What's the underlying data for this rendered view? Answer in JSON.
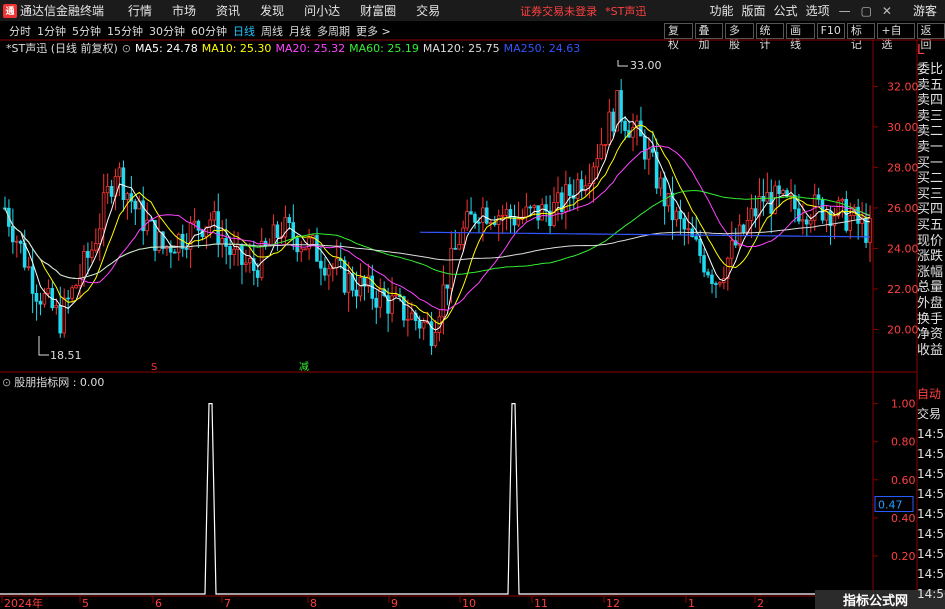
{
  "app": {
    "title": "通达信金融终端",
    "notice": "证券交易未登录",
    "stock_tag": "*ST声迅",
    "guest": "游客"
  },
  "menus": [
    "行情",
    "市场",
    "资讯",
    "发现",
    "问小达",
    "财富圈",
    "交易"
  ],
  "right_menus": [
    "功能",
    "版面",
    "公式",
    "选项"
  ],
  "window_buttons": [
    "—",
    "▢",
    "✕"
  ],
  "periods": [
    "分时",
    "1分钟",
    "5分钟",
    "15分钟",
    "30分钟",
    "60分钟",
    "日线",
    "周线",
    "月线",
    "多周期",
    "更多 >"
  ],
  "active_period": "日线",
  "tool_buttons": [
    "复权",
    "叠加",
    "多股",
    "统计",
    "画线",
    "F10",
    "标记",
    "+自选",
    "返回"
  ],
  "stock_label": "*ST声迅 (日线 前复权)",
  "ma": [
    {
      "label": "MA5: 24.78",
      "color": "#ffffff"
    },
    {
      "label": "MA10: 25.30",
      "color": "#ffff00"
    },
    {
      "label": "MA20: 25.32",
      "color": "#ff44ff"
    },
    {
      "label": "MA60: 25.19",
      "color": "#33ee33"
    },
    {
      "label": "MA120: 25.75",
      "color": "#dddddd"
    },
    {
      "label": "MA250: 24.63",
      "color": "#3355ff"
    }
  ],
  "price_axis": [
    "32.00",
    "30.00",
    "28.00",
    "26.00",
    "24.00",
    "22.00",
    "20.00"
  ],
  "high_label": "33.00",
  "low_label": "18.51",
  "indicator_label": "股朋指标网 : 0.00",
  "ind_axis": [
    "1.00",
    "0.80",
    "0.60",
    "0.40",
    "0.20"
  ],
  "ind_cur": "0.47",
  "markers": [
    "S",
    "减"
  ],
  "x_axis": [
    "2024年",
    "5",
    "6",
    "7",
    "8",
    "9",
    "10",
    "11",
    "12",
    "1",
    "2"
  ],
  "right_panel": [
    "委比",
    "卖五",
    "卖四",
    "卖三",
    "卖二",
    "卖一",
    "买一",
    "买二",
    "买三",
    "买四",
    "买五",
    "现价",
    "涨跌",
    "涨幅",
    "总量",
    "外盘",
    "换手",
    "净资",
    "收益"
  ],
  "right_panel2": [
    "自动",
    "交易",
    "14:55",
    "14:55",
    "14:56",
    "14:56",
    "14:56",
    "14:56",
    "14:56",
    "14:56",
    "14:56"
  ],
  "watermark": {
    "line1": "指标公式网",
    "line2": "www.zbgs3.com"
  }
}
